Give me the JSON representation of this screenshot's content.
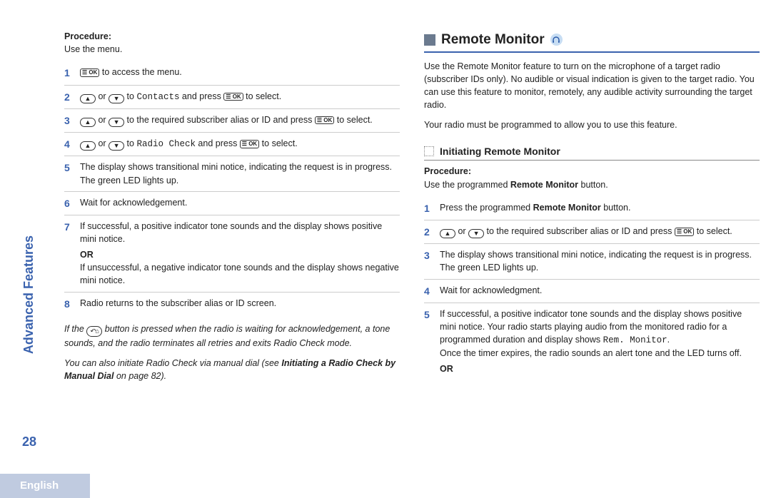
{
  "sidebar": {
    "section_name": "Advanced Features",
    "page_number": "28",
    "language": "English"
  },
  "left": {
    "procedure_label": "Procedure:",
    "procedure_sub": "Use the menu.",
    "steps": [
      {
        "n": "1",
        "pre": "",
        "post": " to access the menu.",
        "kind": "ok_only"
      },
      {
        "n": "2",
        "menu_item": "Contacts",
        "kind": "arrows_to_select"
      },
      {
        "n": "3",
        "text": " to the required subscriber alias or ID and press ",
        "kind": "arrows_then_ok"
      },
      {
        "n": "4",
        "menu_item": "Radio Check",
        "kind": "arrows_to_select"
      },
      {
        "n": "5",
        "text": "The display shows transitional mini notice, indicating the request is in progress. The green LED lights up.",
        "kind": "plain"
      },
      {
        "n": "6",
        "text": "Wait for acknowledgement.",
        "kind": "plain"
      },
      {
        "n": "7",
        "text": "If successful, a positive indicator tone sounds and the display shows positive mini notice.",
        "or": "OR",
        "text2": "If unsuccessful, a negative indicator tone sounds and the display shows negative mini notice.",
        "kind": "or_block"
      },
      {
        "n": "8",
        "text": "Radio returns to the subscriber alias or ID screen.",
        "kind": "plain"
      }
    ],
    "note1_a": "If the ",
    "note1_b": " button is pressed when the radio is waiting for acknowledgement, a tone sounds, and the radio terminates all retries and exits Radio Check mode.",
    "note2_a": "You can also initiate Radio Check via manual dial (see ",
    "note2_bold": "Initiating a Radio Check by Manual Dial",
    "note2_b": " on page 82)."
  },
  "right": {
    "section_title": "Remote Monitor",
    "intro1": "Use the Remote Monitor feature to turn on the microphone of a target radio (subscriber IDs only). No audible or visual indication is given to the target radio. You can use this feature to monitor, remotely, any audible activity surrounding the target radio.",
    "intro2": "Your radio must be programmed to allow you to use this feature.",
    "sub_title": "Initiating Remote Monitor",
    "procedure_label": "Procedure:",
    "procedure_sub_a": "Use the programmed ",
    "procedure_sub_bold": "Remote Monitor",
    "procedure_sub_b": " button.",
    "steps": [
      {
        "n": "1",
        "pre": "Press the programmed ",
        "bold": "Remote Monitor",
        "post": " button.",
        "kind": "bold_mid"
      },
      {
        "n": "2",
        "text": " to the required subscriber alias or ID and press ",
        "kind": "arrows_then_ok"
      },
      {
        "n": "3",
        "text": "The display shows transitional mini notice, indicating the request is in progress. The green LED lights up.",
        "kind": "plain"
      },
      {
        "n": "4",
        "text": "Wait for acknowledgment.",
        "kind": "plain"
      },
      {
        "n": "5",
        "text_a": "If successful, a positive indicator tone sounds and the display shows positive mini notice. Your radio starts playing audio from the monitored radio for a programmed duration and display shows ",
        "mono": "Rem. Monitor",
        "text_b": ".",
        "text_c": "Once the timer expires, the radio sounds an alert tone and the LED turns off.",
        "or": "OR",
        "kind": "step5"
      }
    ]
  },
  "icons": {
    "ok_label": "☰ OK"
  }
}
